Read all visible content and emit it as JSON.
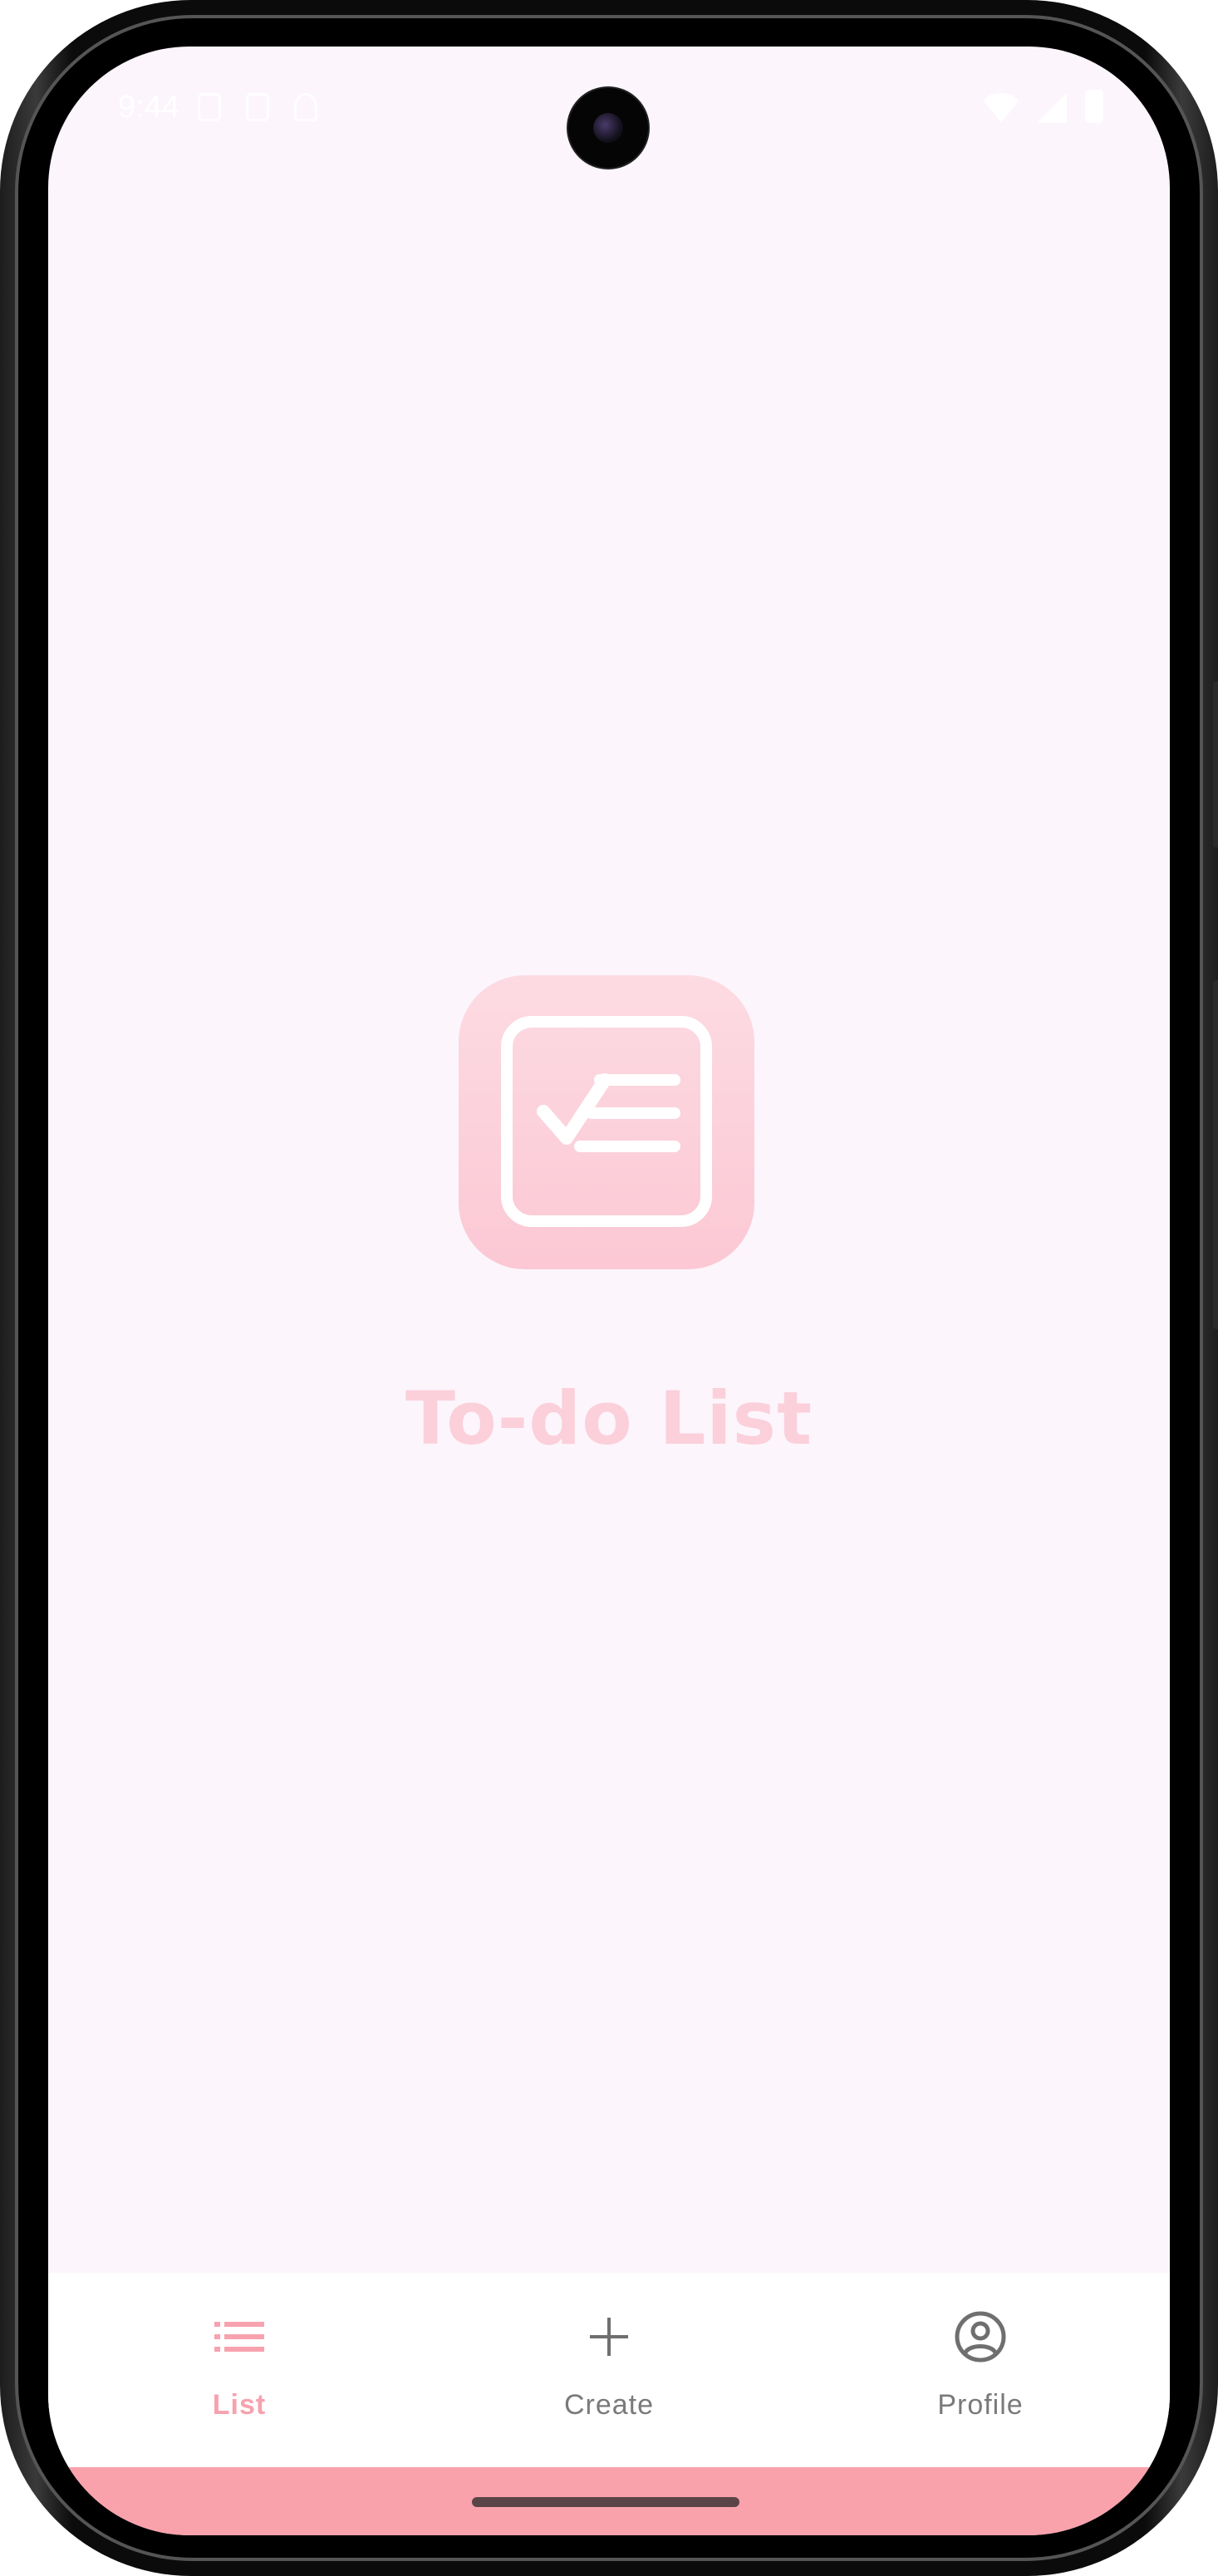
{
  "status_bar": {
    "time": "9:44"
  },
  "splash": {
    "app_title": "To-do List",
    "logo_icon": "checklist-icon",
    "logo_color": "#fbc8d4"
  },
  "bottom_nav": {
    "items": [
      {
        "label": "List",
        "icon": "list-icon",
        "active": true
      },
      {
        "label": "Create",
        "icon": "plus-icon",
        "active": false
      },
      {
        "label": "Profile",
        "icon": "account-circle-icon",
        "active": false
      }
    ],
    "active_color": "#f7a2ae",
    "inactive_color": "#7a7a7a"
  },
  "colors": {
    "background": "#fcf5fc",
    "gesture_bar": "#f9a2ac"
  }
}
